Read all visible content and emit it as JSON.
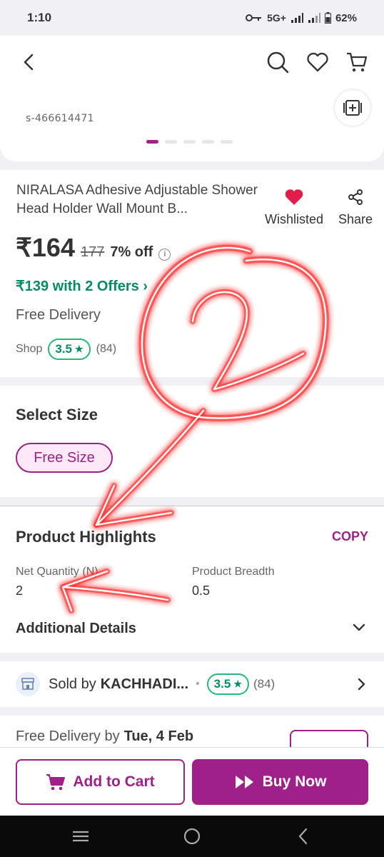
{
  "status_bar": {
    "time": "1:10",
    "network": "5G+",
    "battery": "62%"
  },
  "header": {
    "sku": "s-466614471"
  },
  "product": {
    "title": "NIRALASA  Adhesive Adjustable Shower Head Holder Wall Mount B...",
    "wishlist_label": "Wishlisted",
    "share_label": "Share",
    "price": "₹164",
    "mrp": "177",
    "discount": "7% off",
    "offers": "₹139 with 2 Offers ›",
    "delivery": "Free Delivery",
    "shop_label": "Shop",
    "rating": "3.5",
    "rating_count": "(84)"
  },
  "size": {
    "title": "Select Size",
    "option": "Free Size"
  },
  "highlights": {
    "title": "Product Highlights",
    "copy_label": "COPY",
    "specs": [
      {
        "label": "Net Quantity (N)",
        "value": "2"
      },
      {
        "label": "Product Breadth",
        "value": "0.5"
      }
    ],
    "additional": "Additional Details"
  },
  "seller": {
    "prefix": "Sold by",
    "name": "KACHHADI...",
    "rating": "3.5",
    "count": "(84)"
  },
  "delivery": {
    "text": "Free Delivery by",
    "date": "Tue, 4 Feb"
  },
  "actions": {
    "add_to_cart": "Add to Cart",
    "buy_now": "Buy Now"
  },
  "annotation": {
    "text": "2",
    "color": "#ff2a2a"
  },
  "colors": {
    "brand": "#9f2089",
    "green": "#038d63",
    "heart": "#e11d48"
  }
}
